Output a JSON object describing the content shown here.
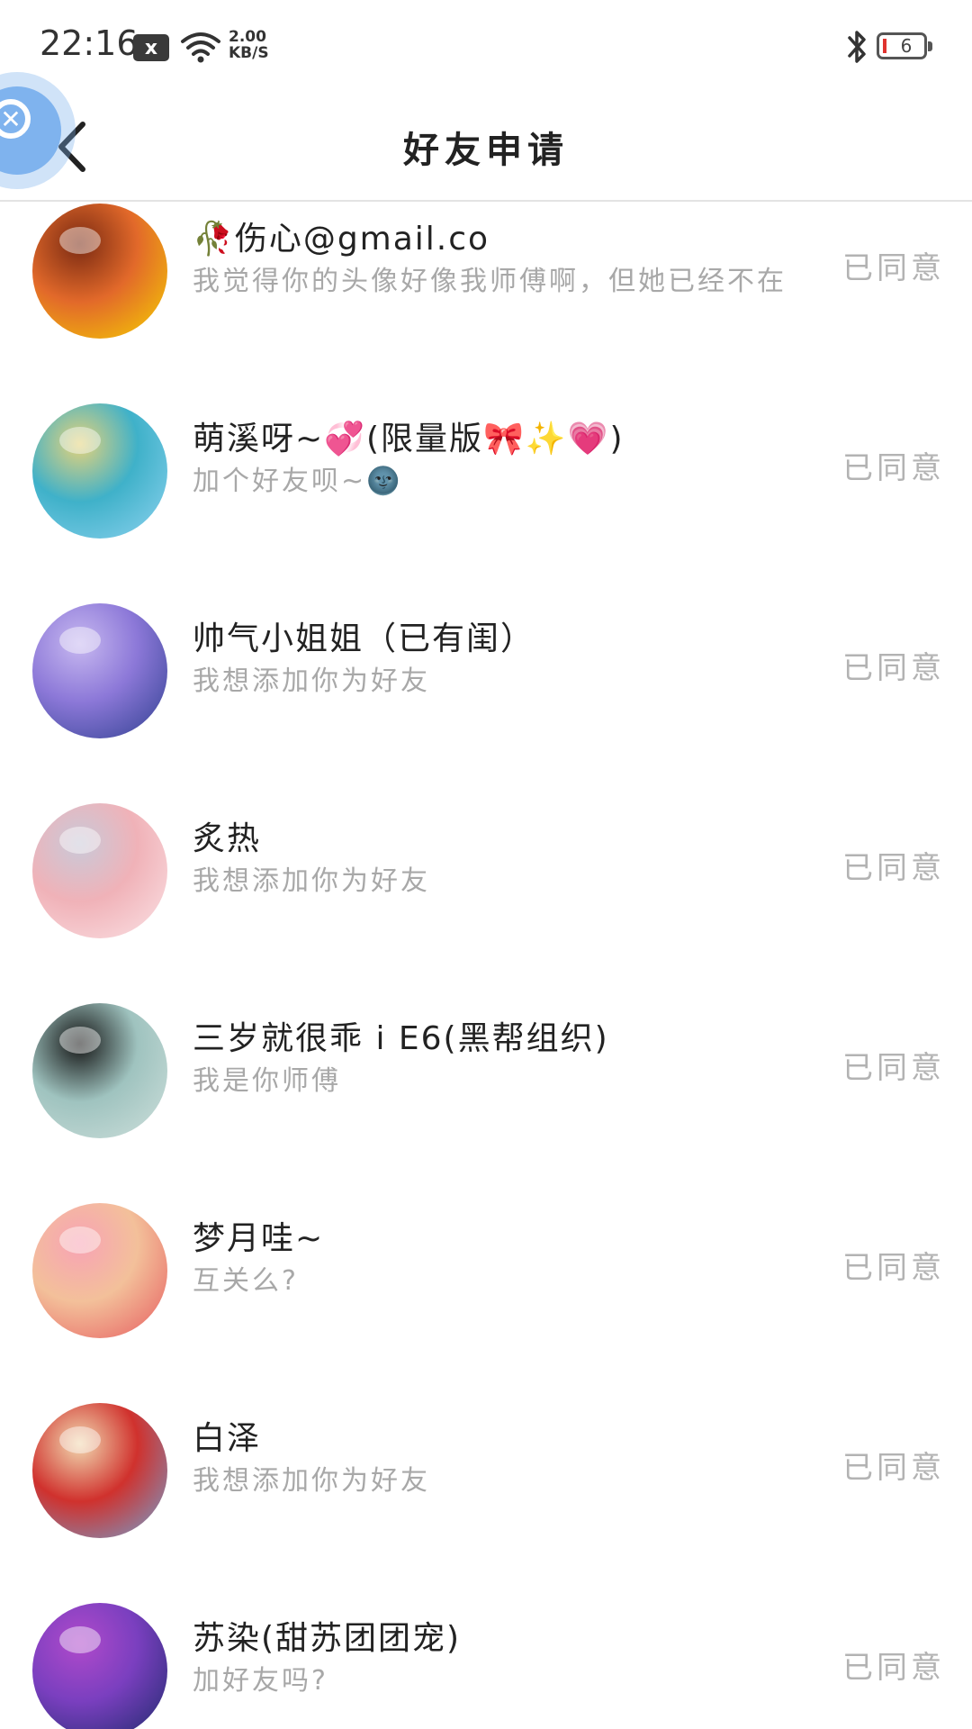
{
  "status_bar": {
    "time": "22:16",
    "notification_icon": "x",
    "speed_value": "2.00",
    "speed_unit": "KB/S",
    "battery_level": "6"
  },
  "nav": {
    "title": "好友申请",
    "back_icon": "chevron-left-icon",
    "floating_ball_icon": "x-circle-icon"
  },
  "colors": {
    "name_text": "#222222",
    "message_text": "#a8a8a8",
    "status_text": "#b3b3b3",
    "divider": "#e3e3e3",
    "floating_ball": "#7fb3ee"
  },
  "requests": [
    {
      "name": "🥀伤心@gmail.co",
      "message": "我觉得你的头像好像我师傅啊，但她已经不在",
      "status": "已同意",
      "avatar_colors": [
        "#f6d200",
        "#e2692a",
        "#7a2a12"
      ]
    },
    {
      "name": "萌溪呀~💞(限量版🎀✨💗)",
      "message": "加个好友呗~🌚",
      "status": "已同意",
      "avatar_colors": [
        "#8fd3f0",
        "#3fb1c9",
        "#e5d27a"
      ]
    },
    {
      "name": "帅气小姐姐（已有闺）",
      "message": "我想添加你为好友",
      "status": "已同意",
      "avatar_colors": [
        "#2e3f8f",
        "#8c78d8",
        "#c7b8f0"
      ]
    },
    {
      "name": "炙热",
      "message": "我想添加你为好友",
      "status": "已同意",
      "avatar_colors": [
        "#fbe3e6",
        "#f0b2b8",
        "#c9c9d8"
      ]
    },
    {
      "name": "三岁就很乖 i E6(黑帮组织)",
      "message": "我是你师傅",
      "status": "已同意",
      "avatar_colors": [
        "#cfe0dc",
        "#9fc3bf",
        "#141414"
      ]
    },
    {
      "name": "梦月哇~",
      "message": "互关么?",
      "status": "已同意",
      "avatar_colors": [
        "#e65a5e",
        "#f3c09a",
        "#f7a3b5"
      ]
    },
    {
      "name": "白泽",
      "message": "我想添加你为好友",
      "status": "已同意",
      "avatar_colors": [
        "#6fa3d4",
        "#d0312d",
        "#f1d9b0"
      ]
    },
    {
      "name": "苏染(甜苏团团宠)",
      "message": "加好友吗?",
      "status": "已同意",
      "avatar_colors": [
        "#1d2b6b",
        "#7a3fbf",
        "#b04acb"
      ]
    }
  ]
}
